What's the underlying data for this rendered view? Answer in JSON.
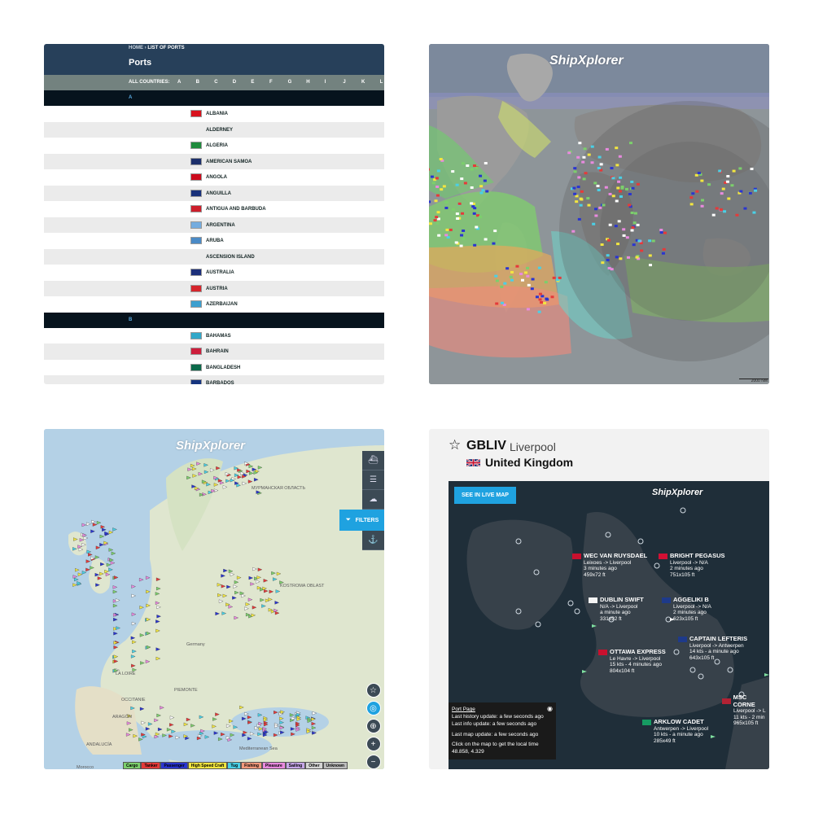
{
  "panel1": {
    "breadcrumb_home": "HOME",
    "breadcrumb_sep": "›",
    "breadcrumb_current": "LIST OF PORTS",
    "title": "Ports",
    "all_countries_label": "ALL COUNTRIES:",
    "letters": [
      "A",
      "B",
      "C",
      "D",
      "E",
      "F",
      "G",
      "H",
      "I",
      "J",
      "K",
      "L"
    ],
    "section_a": "A",
    "section_b": "B",
    "countries_a": [
      {
        "name": "ALBANIA",
        "flag": "#d8121d"
      },
      {
        "name": "ALDERNEY",
        "flag": ""
      },
      {
        "name": "ALGERIA",
        "flag": "#1f8b3d"
      },
      {
        "name": "AMERICAN SAMOA",
        "flag": "#1c2f6b"
      },
      {
        "name": "ANGOLA",
        "flag": "#cc0b1d"
      },
      {
        "name": "ANGUILLA",
        "flag": "#18307a"
      },
      {
        "name": "ANTIGUA AND BARBUDA",
        "flag": "#cd1e2b"
      },
      {
        "name": "ARGENTINA",
        "flag": "#74acdf"
      },
      {
        "name": "ARUBA",
        "flag": "#4a8ac6"
      },
      {
        "name": "ASCENSION ISLAND",
        "flag": ""
      },
      {
        "name": "AUSTRALIA",
        "flag": "#1c2f7a"
      },
      {
        "name": "AUSTRIA",
        "flag": "#d5252c"
      },
      {
        "name": "AZERBAIJAN",
        "flag": "#3c9fcf"
      }
    ],
    "countries_b": [
      {
        "name": "BAHAMAS",
        "flag": "#32a8c9"
      },
      {
        "name": "BAHRAIN",
        "flag": "#cd1e3c"
      },
      {
        "name": "BANGLADESH",
        "flag": "#0b6a4a"
      },
      {
        "name": "BARBADOS",
        "flag": "#16357f"
      }
    ]
  },
  "panel2": {
    "logo": "ShipXplorer",
    "scale": "2000 NM"
  },
  "panel3": {
    "logo": "ShipXplorer",
    "filters_label": "FILTERS",
    "legend": [
      {
        "label": "Cargo",
        "color": "#7ccf6c"
      },
      {
        "label": "Tanker",
        "color": "#e53a3a"
      },
      {
        "label": "Passenger",
        "color": "#2a35d0"
      },
      {
        "label": "High Speed Craft",
        "color": "#f2e640"
      },
      {
        "label": "Tug",
        "color": "#4ad0e6"
      },
      {
        "label": "Fishing",
        "color": "#f49a7c"
      },
      {
        "label": "Pleasure",
        "color": "#e98adf"
      },
      {
        "label": "Sailing",
        "color": "#c6a6e8"
      },
      {
        "label": "Other",
        "color": "#d4d4d4"
      },
      {
        "label": "Unknown",
        "color": "#bcbcbc"
      }
    ],
    "labels": [
      {
        "text": "МУРМАНСКАЯ ОБЛАСТЬ"
      },
      {
        "text": "KOSTROMA OBLAST"
      },
      {
        "text": "LA LOIRE"
      },
      {
        "text": "OCCITANIE"
      },
      {
        "text": "ARAGÓN"
      },
      {
        "text": "ANDALUCÍA"
      },
      {
        "text": "PIEMONTE"
      },
      {
        "text": "Morocco"
      },
      {
        "text": "Mediterranean Sea"
      },
      {
        "text": "Germany"
      }
    ]
  },
  "panel4": {
    "code": "GBLIV",
    "city": "Liverpool",
    "country": "United Kingdom",
    "live_map_label": "SEE IN LIVE MAP",
    "logo": "ShipXplorer",
    "ships": [
      {
        "name": "WEC VAN RUYSDAEL",
        "route": "Leixoes -> Liverpool",
        "time": "3 minutes ago",
        "size": "459x72 ft",
        "flag": "#c8102e"
      },
      {
        "name": "BRIGHT PEGASUS",
        "route": "Liverpool -> N/A",
        "time": "2 minutes ago",
        "size": "751x105 ft",
        "flag": "#d21034"
      },
      {
        "name": "DUBLIN SWIFT",
        "route": "N/A -> Liverpool",
        "time": "a minute ago",
        "size": "331x92 ft",
        "flag": "#f4f4f4"
      },
      {
        "name": "AGGELIKI B",
        "route": "Liverpool -> N/A",
        "time": "2 minutes ago",
        "size": "623x105 ft",
        "flag": "#1e3a8a"
      },
      {
        "name": "CAPTAIN LEFTERIS",
        "route": "Liverpool -> Antwerpen",
        "time": "14 kts - a minute ago",
        "size": "643x105 ft",
        "flag": "#1e3a8a"
      },
      {
        "name": "OTTAWA EXPRESS",
        "route": "Le Havre -> Liverpool",
        "time": "15 kts - 4 minutes ago",
        "size": "804x104 ft",
        "flag": "#c8102e"
      },
      {
        "name": "MSC CORNE",
        "route": "Liverpool -> L",
        "time": "11 kts - 2 min",
        "size": "965x105 ft",
        "flag": "#b22234"
      },
      {
        "name": "ARKLOW CADET",
        "route": "Antwerpen -> Liverpool",
        "time": "10 kts - a minute ago",
        "size": "285x49 ft",
        "flag": "#169b62"
      }
    ],
    "info": {
      "port_page": "Port Page",
      "history": "Last history update: a few seconds ago",
      "info_update": "Last info update: a few seconds ago",
      "map_update": "Last map update: a few seconds ago",
      "click_hint": "Click on the map to get the local time",
      "coords": "48.858, 4.329"
    }
  }
}
